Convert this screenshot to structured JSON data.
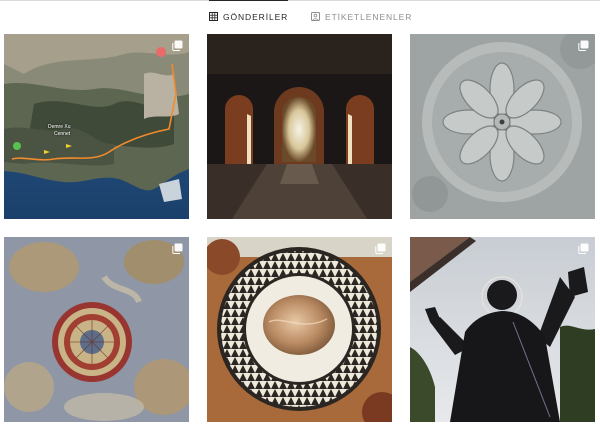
{
  "tabs": [
    {
      "label": "GÖNDERİLER",
      "icon": "grid-icon",
      "active": true
    },
    {
      "label": "ETİKETLENENLER",
      "icon": "tagged-icon",
      "active": false
    }
  ],
  "posts": [
    {
      "subject": "map-aerial-post",
      "multiple": true,
      "map_labels": [
        "Demre Xu",
        "Cennet"
      ]
    },
    {
      "subject": "archway-post",
      "multiple": false
    },
    {
      "subject": "stone-rosette-post",
      "multiple": true
    },
    {
      "subject": "fresco-ceiling-post",
      "multiple": true
    },
    {
      "subject": "mosaic-floor-post",
      "multiple": true
    },
    {
      "subject": "saint-statue-post",
      "multiple": true
    }
  ],
  "colors": {
    "active_tab": "#262626",
    "inactive_tab": "#8e8e8e",
    "border": "#dbdbdb"
  }
}
